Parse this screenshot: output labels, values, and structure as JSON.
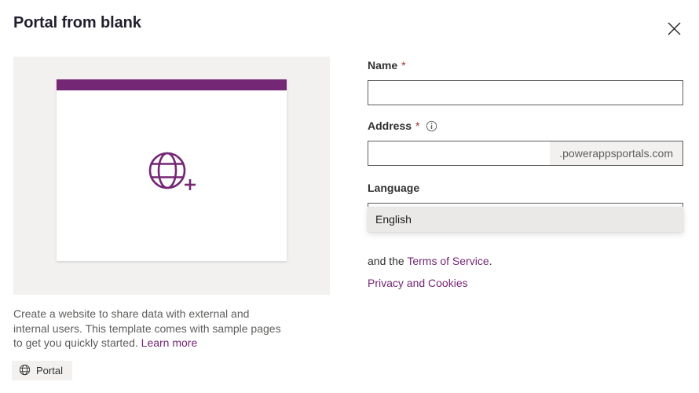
{
  "dialog": {
    "title": "Portal from blank",
    "close_icon": "close-icon"
  },
  "preview": {
    "card_icon": "globe-plus-icon",
    "accent_color": "#742774",
    "panel_background": "#f2f1f0"
  },
  "description": {
    "text": "Create a website to share data with external and internal users. This template comes with sample pages to get you quickly started.",
    "learn_more_label": "Learn more"
  },
  "tag": {
    "icon": "globe-icon",
    "label": "Portal"
  },
  "form": {
    "name": {
      "label": "Name",
      "required_marker": "*",
      "value": "",
      "placeholder": ""
    },
    "address": {
      "label": "Address",
      "required_marker": "*",
      "info_icon": "info-icon",
      "value": "",
      "placeholder": "",
      "suffix": ".powerappsportals.com"
    },
    "language": {
      "label": "Language",
      "selected": "English",
      "chevron_icon": "chevron-down-icon",
      "options": [
        "English"
      ]
    }
  },
  "legal": {
    "prefix": "and the ",
    "terms_link": "Terms of Service",
    "suffix": ".",
    "privacy_link": "Privacy and Cookies"
  }
}
